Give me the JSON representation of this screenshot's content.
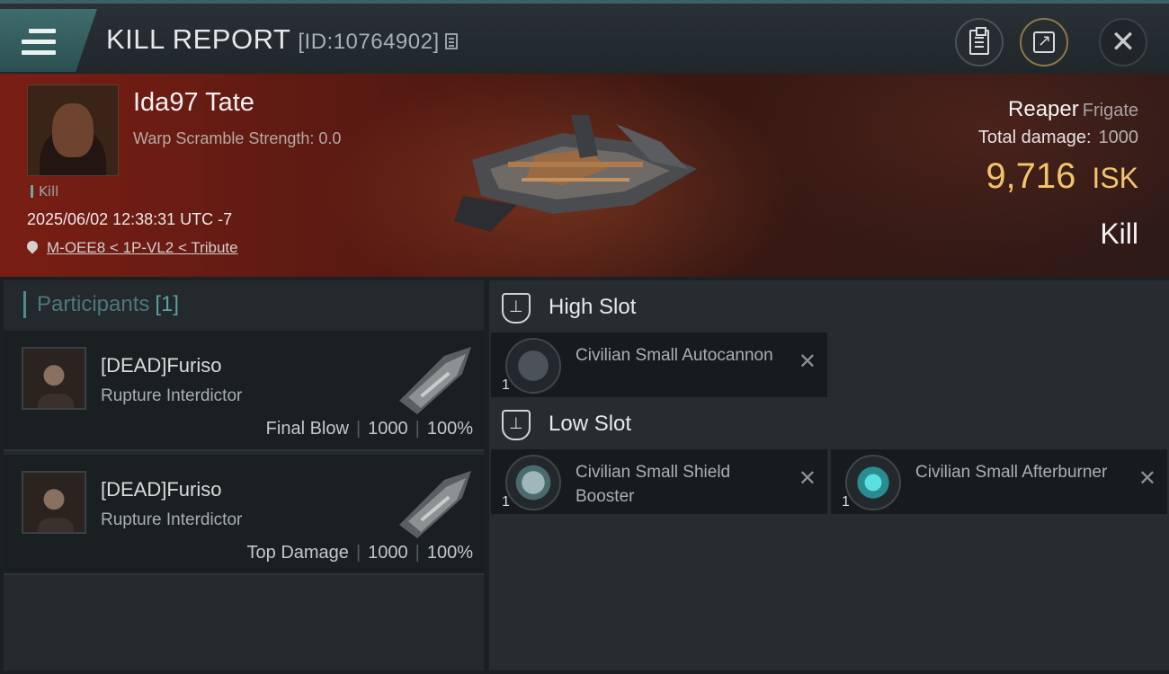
{
  "header": {
    "title": "KILL REPORT",
    "id_label": "[ID:10764902]",
    "icons": [
      "menu-icon",
      "copy-icon",
      "clipboard-icon",
      "share-icon",
      "close-icon"
    ]
  },
  "victim": {
    "name": "Ida97 Tate",
    "warp_scramble": "Warp Scramble Strength: 0.0",
    "tag": "Kill",
    "datetime": "2025/06/02 12:38:31 UTC -7",
    "location": "M-OEE8 < 1P-VL2 < Tribute"
  },
  "ship": {
    "name": "Reaper",
    "class": "Frigate",
    "total_damage_label": "Total damage:",
    "total_damage": "1000",
    "isk_value": "9,716",
    "isk_unit": "ISK",
    "result": "Kill"
  },
  "participants": {
    "heading": "Participants",
    "count": "[1]",
    "rows": [
      {
        "name": "[DEAD]Furiso",
        "ship": "Rupture Interdictor",
        "role": "Final Blow",
        "damage": "1000",
        "percent": "100%"
      },
      {
        "name": "[DEAD]Furiso",
        "ship": "Rupture Interdictor",
        "role": "Top Damage",
        "damage": "1000",
        "percent": "100%"
      }
    ]
  },
  "slots": {
    "high_label": "High Slot",
    "low_label": "Low Slot",
    "high": [
      {
        "name": "Civilian Small Autocannon",
        "qty": "1"
      }
    ],
    "low": [
      {
        "name": "Civilian Small Shield Booster",
        "qty": "1"
      },
      {
        "name": "Civilian Small Afterburner",
        "qty": "1"
      }
    ],
    "x_glyph": "✕"
  },
  "colors": {
    "accent_teal": "#4f8d8c",
    "isk_gold": "#f2c46a",
    "hero_red": "#7a1e14"
  }
}
